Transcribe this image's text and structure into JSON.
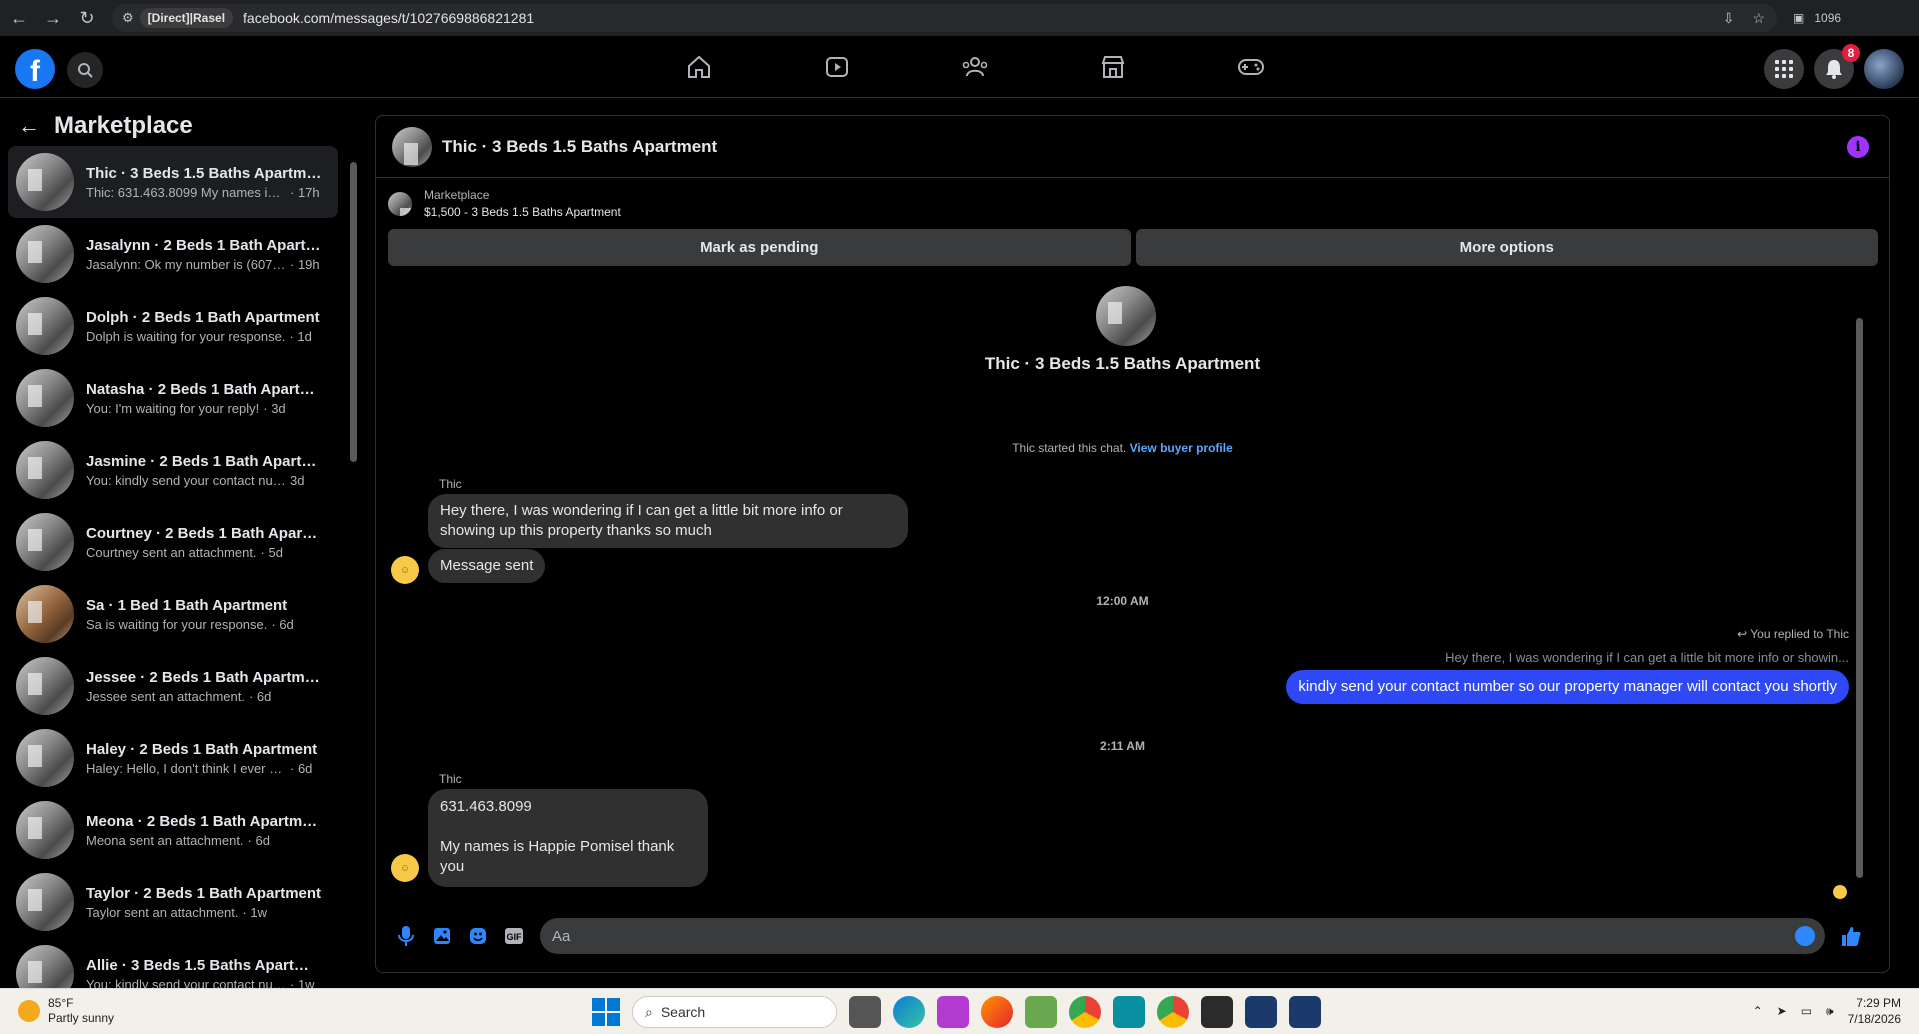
{
  "browser": {
    "profile_chip": "[Direct]|Rasel",
    "url": "facebook.com/messages/t/1027669886821281",
    "ext_label": "1096"
  },
  "header": {
    "logo_letter": "f",
    "notifications_count": "8",
    "nav_icons": [
      "home-icon",
      "video-icon",
      "groups-icon",
      "marketplace-icon",
      "gaming-icon"
    ]
  },
  "sidebar": {
    "title": "Marketplace",
    "items": [
      {
        "title": "Thic · 3 Beds 1.5 Baths Apartment",
        "preview": "Thic: 631.463.8099 My names is H...",
        "time": "· 17h",
        "active": true
      },
      {
        "title": "Jasalynn · 2 Beds 1 Bath Apartm...",
        "preview": "Jasalynn: Ok my number is (607)-...",
        "time": "· 19h"
      },
      {
        "title": "Dolph · 2 Beds 1 Bath Apartment",
        "preview": "Dolph is waiting for your response.",
        "time": "· 1d"
      },
      {
        "title": "Natasha · 2 Beds 1 Bath Apartm...",
        "preview": "You: I'm waiting for your reply!",
        "time": "· 3d"
      },
      {
        "title": "Jasmine · 2 Beds 1 Bath Apartme...",
        "preview": "You: kindly send your contact num...",
        "time": "3d"
      },
      {
        "title": "Courtney · 2 Beds 1 Bath Apartm...",
        "preview": "Courtney sent an attachment.",
        "time": "· 5d"
      },
      {
        "title": "Sa · 1 Bed 1 Bath Apartment",
        "preview": "Sa is waiting for your response.",
        "time": "· 6d"
      },
      {
        "title": "Jessee · 2 Beds 1 Bath Apartment",
        "preview": "Jessee sent an attachment.",
        "time": "· 6d"
      },
      {
        "title": "Haley · 2 Beds 1 Bath Apartment",
        "preview": "Haley: Hello, I don't think I ever got...",
        "time": "· 6d"
      },
      {
        "title": "Meona · 2 Beds 1 Bath Apartment",
        "preview": "Meona sent an attachment.",
        "time": "· 6d"
      },
      {
        "title": "Taylor · 2 Beds 1 Bath Apartment",
        "preview": "Taylor sent an attachment.",
        "time": "· 1w"
      },
      {
        "title": "Allie · 3 Beds 1.5 Baths Apartment",
        "preview": "You: kindly send your contact num...",
        "time": "· 1w"
      }
    ]
  },
  "chat": {
    "title": "Thic · 3 Beds 1.5 Baths Apartment",
    "listing_label": "Marketplace",
    "listing_detail": "$1,500 - 3 Beds 1.5 Baths Apartment",
    "mark_pending": "Mark as pending",
    "more_options": "More options",
    "started_text": "Thic started this chat.",
    "view_profile": "View buyer profile",
    "sender_name": "Thic",
    "msg1": "Hey there, I was wondering if I can get a little bit more info or showing up this property thanks so much",
    "msg2": "Message sent",
    "time1": "12:00 AM",
    "replied_note": "You replied to Thic",
    "quoted": "Hey there, I was wondering if I can get a little bit more info or showin...",
    "out_msg": "kindly send your contact number so our property manager will contact you shortly",
    "time2": "2:11 AM",
    "msg3_line1": "631.463.8099",
    "msg3_line2": "My names is Happie Pomisel thank you",
    "composer_placeholder": "Aa"
  },
  "taskbar": {
    "temp": "85°F",
    "weather": "Partly sunny",
    "search": "Search",
    "time": "7:29 PM",
    "date": "7/18/2026"
  }
}
